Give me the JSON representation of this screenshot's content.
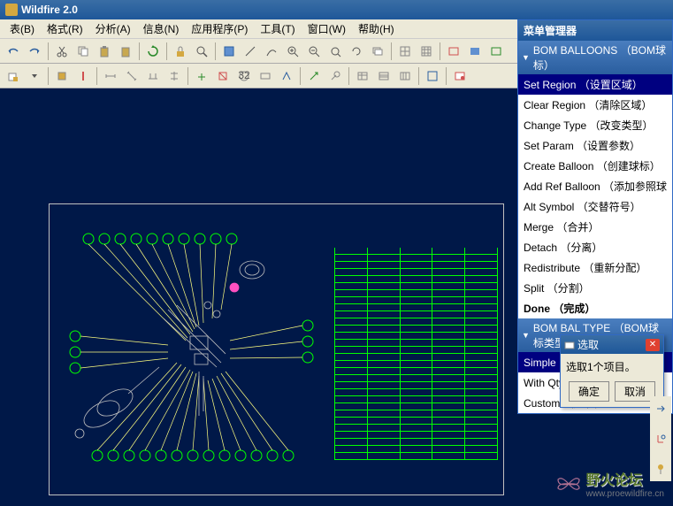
{
  "title": "Wildfire 2.0",
  "menubar": [
    "表(B)",
    "格式(R)",
    "分析(A)",
    "信息(N)",
    "应用程序(P)",
    "工具(T)",
    "窗口(W)",
    "帮助(H)"
  ],
  "menu_manager": {
    "title": "菜单管理器",
    "sections": [
      {
        "header": "BOM BALLOONS （BOM球标）",
        "items": [
          {
            "label": "Set Region （设置区域）",
            "selected": true
          },
          {
            "label": "Clear Region （清除区域）"
          },
          {
            "label": "Change Type （改变类型）"
          },
          {
            "label": "Set Param （设置参数）"
          },
          {
            "label": "Create Balloon （创建球标）"
          },
          {
            "label": "Add Ref Balloon （添加参照球"
          },
          {
            "label": "Alt Symbol （交替符号）"
          },
          {
            "label": "Merge （合并）"
          },
          {
            "label": "Detach （分离）"
          },
          {
            "label": "Redistribute （重新分配）"
          },
          {
            "label": "Split （分割）"
          },
          {
            "label": "Done （完成）",
            "bold": true
          }
        ]
      },
      {
        "header": "BOM BAL TYPE （BOM球标类型",
        "items": [
          {
            "label": "Simple （简单）",
            "selected": true
          },
          {
            "label": "With Qty （带数量）"
          },
          {
            "label": "Custom （定制）"
          }
        ]
      }
    ]
  },
  "dialog": {
    "title": "选取",
    "message": "选取1个项目。",
    "ok": "确定",
    "cancel": "取消"
  },
  "watermark": {
    "text": "野火论坛",
    "url": "www.proewildfire.cn"
  }
}
